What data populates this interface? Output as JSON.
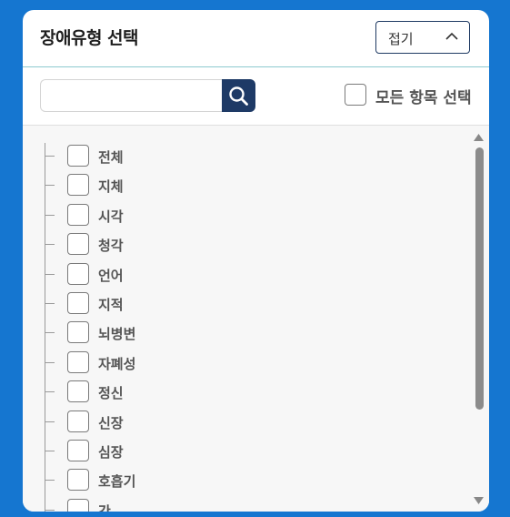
{
  "header": {
    "title": "장애유형 선택",
    "collapse_label": "접기"
  },
  "search": {
    "placeholder": "",
    "value": "",
    "select_all_label": "모든 항목 선택"
  },
  "list": {
    "items": [
      {
        "label": "전체"
      },
      {
        "label": "지체"
      },
      {
        "label": "시각"
      },
      {
        "label": "청각"
      },
      {
        "label": "언어"
      },
      {
        "label": "지적"
      },
      {
        "label": "뇌병변"
      },
      {
        "label": "자폐성"
      },
      {
        "label": "정신"
      },
      {
        "label": "신장"
      },
      {
        "label": "심장"
      },
      {
        "label": "호흡기"
      },
      {
        "label": "간"
      }
    ]
  },
  "colors": {
    "background": "#1576d0",
    "accent": "#1e3a66",
    "header_divider": "#8cc9cf"
  }
}
